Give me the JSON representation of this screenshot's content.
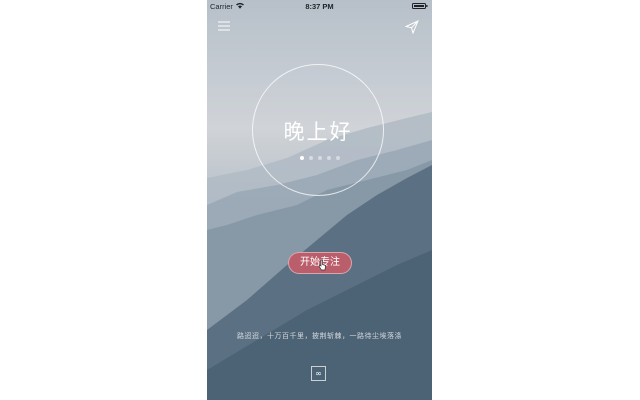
{
  "status_bar": {
    "carrier": "Carrier",
    "time": "8:37 PM"
  },
  "hero": {
    "greeting": "晚上好",
    "page_dots": {
      "count": 5,
      "active_index": 0
    }
  },
  "start_button": {
    "label": "开始专注"
  },
  "quote": {
    "text": "路迢迢，十万百千里，披荆斩棘，一路待尘埃落涤"
  },
  "footer": {
    "infinity_label": "∞"
  },
  "icons": {
    "menu": "menu-icon",
    "send": "send-icon",
    "wifi": "wifi-icon",
    "battery": "battery-icon",
    "cursor": "cursor-icon"
  },
  "colors": {
    "button": "#bb5e6c",
    "text": "#ffffff"
  }
}
